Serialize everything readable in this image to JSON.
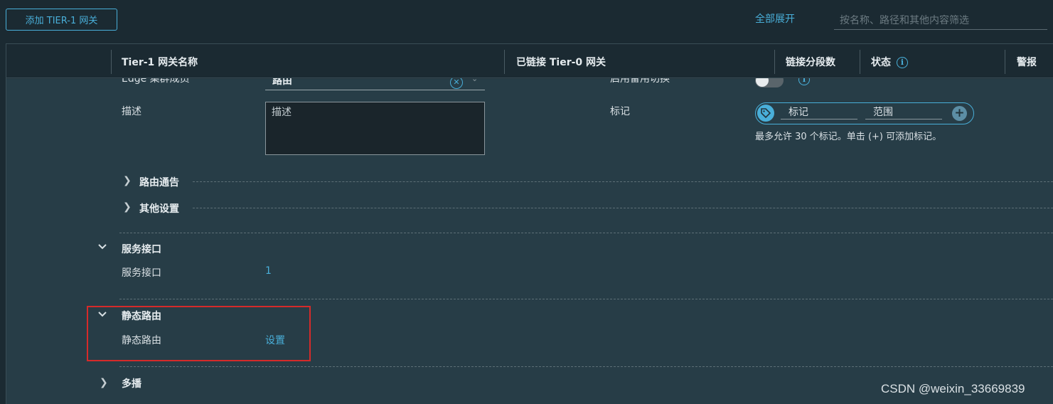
{
  "toolbar": {
    "add_button": "添加 TIER-1 网关",
    "expand_all": "全部展开",
    "filter_placeholder": "按名称、路径和其他内容筛选"
  },
  "columns": [
    {
      "label": "Tier-1 网关名称"
    },
    {
      "label": "已链接 Tier-0 网关"
    },
    {
      "label": "链接分段数"
    },
    {
      "label": "状态"
    },
    {
      "label": "警报"
    }
  ],
  "form": {
    "edge_label_partial": "Edge 集群成员",
    "edge_value": "路由",
    "failover_label_partial": "启用备用切换",
    "desc_label": "描述",
    "desc_placeholder": "描述",
    "tags_label": "标记",
    "tag_placeholder": "标记",
    "scope_placeholder": "范围",
    "tags_hint": "最多允许 30 个标记。单击 (+) 可添加标记。"
  },
  "sections": {
    "route_advertisement": "路由通告",
    "other_settings": "其他设置",
    "service_interface_title": "服务接口",
    "service_interface_label": "服务接口",
    "service_interface_value": "1",
    "static_routes_title": "静态路由",
    "static_routes_label": "静态路由",
    "static_routes_link": "设置",
    "multicast_title": "多播"
  },
  "watermark": "CSDN @weixin_33669839",
  "colors": {
    "accent": "#49afd9",
    "highlight": "#d62a2a",
    "background": "#273d47"
  }
}
